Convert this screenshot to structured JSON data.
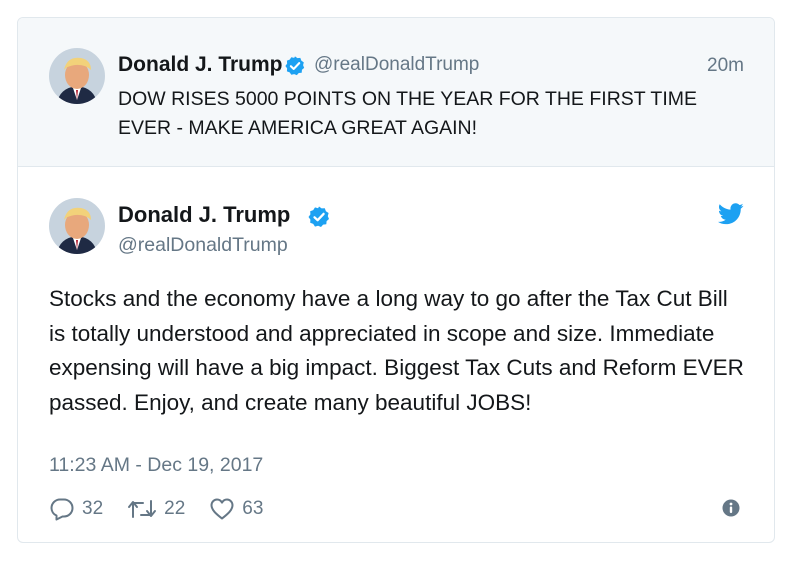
{
  "quoted_tweet": {
    "author_name": "Donald J. Trump",
    "handle": "@realDonaldTrump",
    "time": "20m",
    "text": "DOW RISES 5000 POINTS ON THE YEAR FOR THE FIRST TIME EVER - MAKE AMERICA GREAT AGAIN!"
  },
  "main_tweet": {
    "author_name": "Donald J. Trump",
    "handle": "@realDonaldTrump",
    "text": "Stocks and the economy have a long way to go after the Tax Cut Bill is totally understood and appreciated in scope and size. Immediate expensing will have a big impact. Biggest Tax Cuts and Reform EVER passed. Enjoy, and create many beautiful JOBS!",
    "timestamp": "11:23 AM - Dec 19, 2017",
    "actions": {
      "reply_count": "32",
      "retweet_count": "22",
      "like_count": "63"
    }
  },
  "icons": {
    "verified": "verified-badge-icon",
    "brand": "twitter-bird-icon",
    "reply": "reply-icon",
    "retweet": "retweet-icon",
    "like": "heart-icon",
    "info": "info-icon"
  },
  "colors": {
    "brand_blue": "#1da1f2",
    "secondary_text": "#657786",
    "quoted_background": "#f5f8fa",
    "border": "#e1e8ed"
  }
}
